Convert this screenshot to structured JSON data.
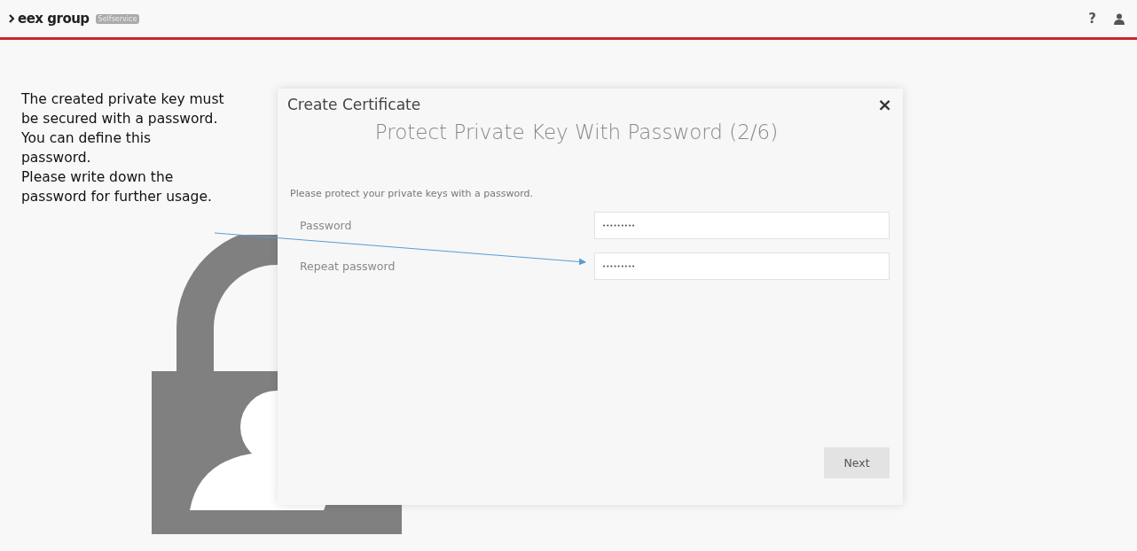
{
  "header": {
    "logo": "eex group",
    "badge": "Selfservice",
    "help": "?"
  },
  "callout": {
    "lines": [
      "The created private key must",
      "be secured with a password.",
      "You can define this",
      "password.",
      "Please write down the",
      "password for further usage."
    ]
  },
  "dialog": {
    "title": "Create Certificate",
    "close": "×",
    "heading": "Protect Private Key With Password (2/6)",
    "instruction": "Please protect your private keys with a password.",
    "fields": [
      {
        "label": "Password",
        "value": "•••••••••"
      },
      {
        "label": "Repeat password",
        "value": "•••••••••"
      }
    ],
    "button": "Next"
  }
}
